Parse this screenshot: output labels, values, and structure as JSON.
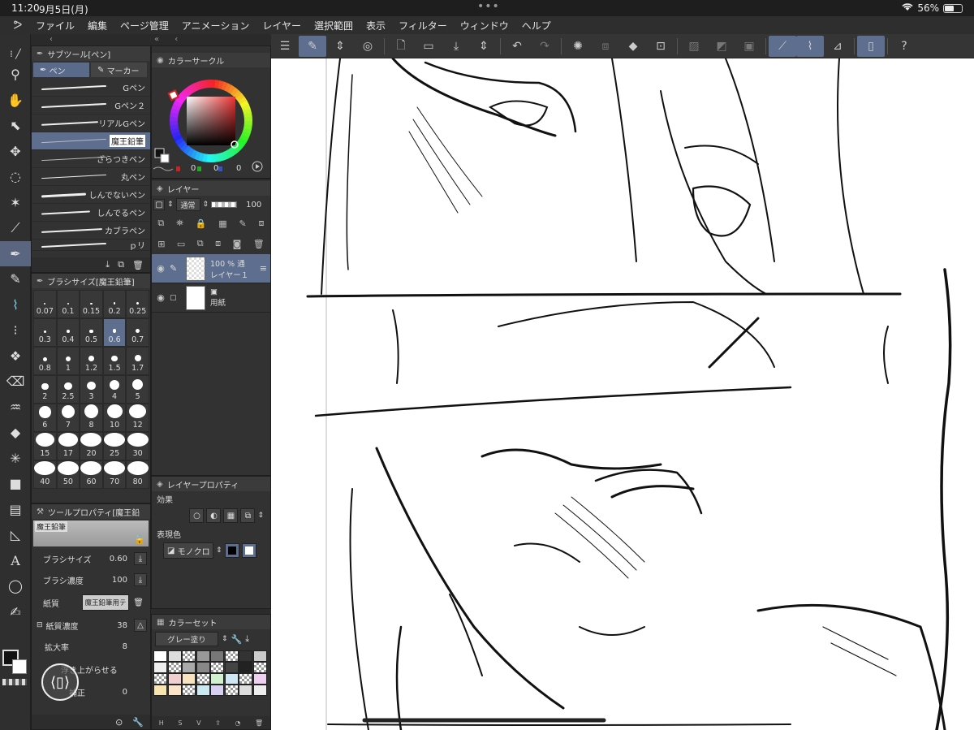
{
  "status": {
    "time": "11:20",
    "date": "9月5日(月)",
    "battery": "56%",
    "battery_level": 0.56
  },
  "menu": [
    "ファイル",
    "編集",
    "ページ管理",
    "アニメーション",
    "レイヤー",
    "選択範囲",
    "表示",
    "フィルター",
    "ウィンドウ",
    "ヘルプ"
  ],
  "toolbar_icons": [
    "hamburger-icon",
    "edit-icon",
    "updown-icon",
    "refresh-icon",
    "new-file-icon",
    "open-folder-icon",
    "save-icon",
    "updown-icon",
    "undo-icon",
    "redo-icon",
    "loading-icon",
    "crop-icon",
    "fill-icon",
    "transform-icon",
    "mask-icon",
    "gradient-icon",
    "frame-icon",
    "pen-pressure-icon",
    "brush-pressure-icon",
    "ruler-icon",
    "device-icon",
    "help-icon"
  ],
  "subtool": {
    "title": "サブツール[ペン]",
    "tabs": [
      "ペン",
      "マーカー"
    ],
    "brushes": [
      "Gペン",
      "Gペン２",
      "リアルGペン",
      "魔王鉛筆",
      "ざらつきペン",
      "丸ペン",
      "しんでないペン",
      "しんでるペン",
      "カブラペン",
      "ｐリ"
    ],
    "selected": "魔王鉛筆"
  },
  "brushsize": {
    "title": "ブラシサイズ[魔王鉛筆]",
    "sizes": [
      "0.07",
      "0.1",
      "0.15",
      "0.2",
      "0.25",
      "0.3",
      "0.4",
      "0.5",
      "0.6",
      "0.7",
      "0.8",
      "1",
      "1.2",
      "1.5",
      "1.7",
      "2",
      "2.5",
      "3",
      "4",
      "5",
      "6",
      "7",
      "8",
      "10",
      "12",
      "15",
      "17",
      "20",
      "25",
      "30",
      "40",
      "50",
      "60",
      "70",
      "80"
    ],
    "selected": "0.6"
  },
  "toolprop": {
    "title": "ツールプロパティ[魔王鉛",
    "preset_name": "魔王鉛筆",
    "brush_size_label": "ブラシサイズ",
    "brush_size": "0.60",
    "density_label": "ブラシ濃度",
    "density": "100",
    "paper_label": "紙質",
    "paper_value": "魔王鉛筆用テ",
    "paper_density_label": "紙質濃度",
    "paper_density": "38",
    "scale_label": "拡大率",
    "scale": "8",
    "raise_label": "浮き上がらせる",
    "correction_label": "補正",
    "correction": "0"
  },
  "colorcircle": {
    "title": "カラーサークル",
    "r": "0",
    "g": "0",
    "b": "0"
  },
  "layer": {
    "title": "レイヤー",
    "blend": "通常",
    "opacity": "100",
    "layers": [
      {
        "opacity": "100 %",
        "mode": "通",
        "name": "レイヤー１"
      },
      {
        "name": "用紙"
      }
    ]
  },
  "layerprop": {
    "title": "レイヤープロパティ",
    "effect_label": "効果",
    "color_label": "表現色",
    "color_value": "モノクロ"
  },
  "colorset": {
    "title": "カラーセット",
    "name": "グレー塗り"
  },
  "colors": {
    "accent": "#5d6e8e",
    "canvas": "#ffffff",
    "panel": "#323232"
  }
}
